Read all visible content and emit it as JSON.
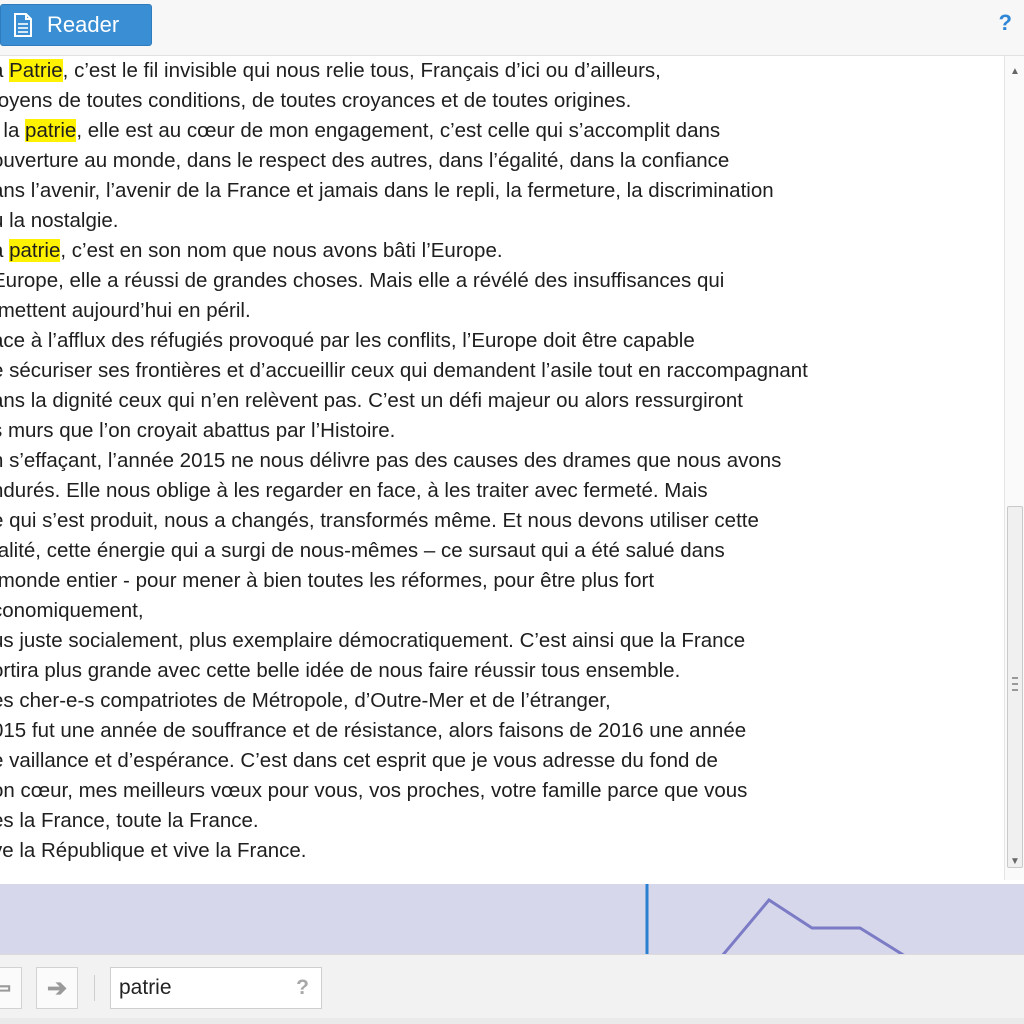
{
  "toolbar": {
    "reader_label": "Reader",
    "help_label": "?"
  },
  "reader": {
    "highlight_color": "#fff200",
    "lines": [
      [
        {
          "t": "a "
        },
        {
          "t": "Patrie",
          "hl": true
        },
        {
          "t": ", c’est le fil invisible qui nous relie tous, Français d’ici ou d’ailleurs,"
        }
      ],
      [
        {
          "t": "toyens de toutes conditions, de toutes croyances et de toutes origines."
        }
      ],
      [
        {
          "t": "t la "
        },
        {
          "t": "patrie",
          "hl": true
        },
        {
          "t": ", elle est au cœur de mon engagement, c’est celle qui s’accomplit dans"
        }
      ],
      [
        {
          "t": "ouverture au monde, dans le respect des autres, dans l’égalité, dans la confiance"
        }
      ],
      [
        {
          "t": "ans l’avenir, l’avenir de la France et jamais dans le repli, la fermeture, la discrimination"
        }
      ],
      [
        {
          "t": "u la nostalgie."
        }
      ],
      [
        {
          "t": "a "
        },
        {
          "t": "patrie",
          "hl": true
        },
        {
          "t": ", c’est en son nom que nous avons bâti l’Europe."
        }
      ],
      [
        {
          "t": "Europe, elle a réussi de grandes choses. Mais elle a révélé des insuffisances qui"
        }
      ],
      [
        {
          "t": " mettent aujourd’hui en péril."
        }
      ],
      [
        {
          "t": "ace à l’afflux des réfugiés provoqué par les conflits, l’Europe doit être capable"
        }
      ],
      [
        {
          "t": "e sécuriser ses frontières et d’accueillir ceux qui demandent l’asile tout en raccompagnant"
        }
      ],
      [
        {
          "t": "ans la dignité ceux qui n’en relèvent pas. C’est un défi majeur ou alors ressurgiront"
        }
      ],
      [
        {
          "t": "s murs que l’on croyait abattus par l’Histoire."
        }
      ],
      [
        {
          "t": "n s’effaçant, l’année 2015 ne nous délivre pas des causes des drames que nous avons"
        }
      ],
      [
        {
          "t": "ndurés. Elle nous oblige à les regarder en face, à les traiter avec fermeté. Mais"
        }
      ],
      [
        {
          "t": "e qui s’est produit, nous a changés, transformés même. Et nous devons utiliser cette"
        }
      ],
      [
        {
          "t": "talité, cette énergie qui a surgi de nous-mêmes – ce sursaut qui a été salué dans"
        }
      ],
      [
        {
          "t": " monde entier - pour mener à bien toutes les réformes, pour être plus fort"
        }
      ],
      [
        {
          "t": "conomiquement,"
        }
      ],
      [
        {
          "t": "us juste socialement, plus exemplaire démocratiquement. C’est ainsi que la France"
        }
      ],
      [
        {
          "t": "ortira plus grande avec cette belle idée de nous faire réussir tous ensemble."
        }
      ],
      [
        {
          "t": "es cher-e-s compatriotes de Métropole, d’Outre-Mer et de l’étranger,"
        }
      ],
      [
        {
          "t": "015 fut une année de souffrance et de résistance, alors faisons de 2016 une année"
        }
      ],
      [
        {
          "t": "e vaillance et d’espérance. C’est dans cet esprit que je vous adresse du fond de"
        }
      ],
      [
        {
          "t": "on cœur, mes meilleurs vœux pour vous, vos proches, votre famille parce que vous"
        }
      ],
      [
        {
          "t": "es la France, toute la France."
        }
      ],
      [
        {
          "t": "ve la République et vive la France."
        }
      ]
    ]
  },
  "timeline": {
    "background_color": "#d7d7ec",
    "marker_color": "#2a7fd0",
    "line_color": "#7b7bc6"
  },
  "search": {
    "query": "patrie",
    "help_label": "?",
    "prev_icon": "arrow-left-icon",
    "next_icon": "arrow-right-icon"
  }
}
